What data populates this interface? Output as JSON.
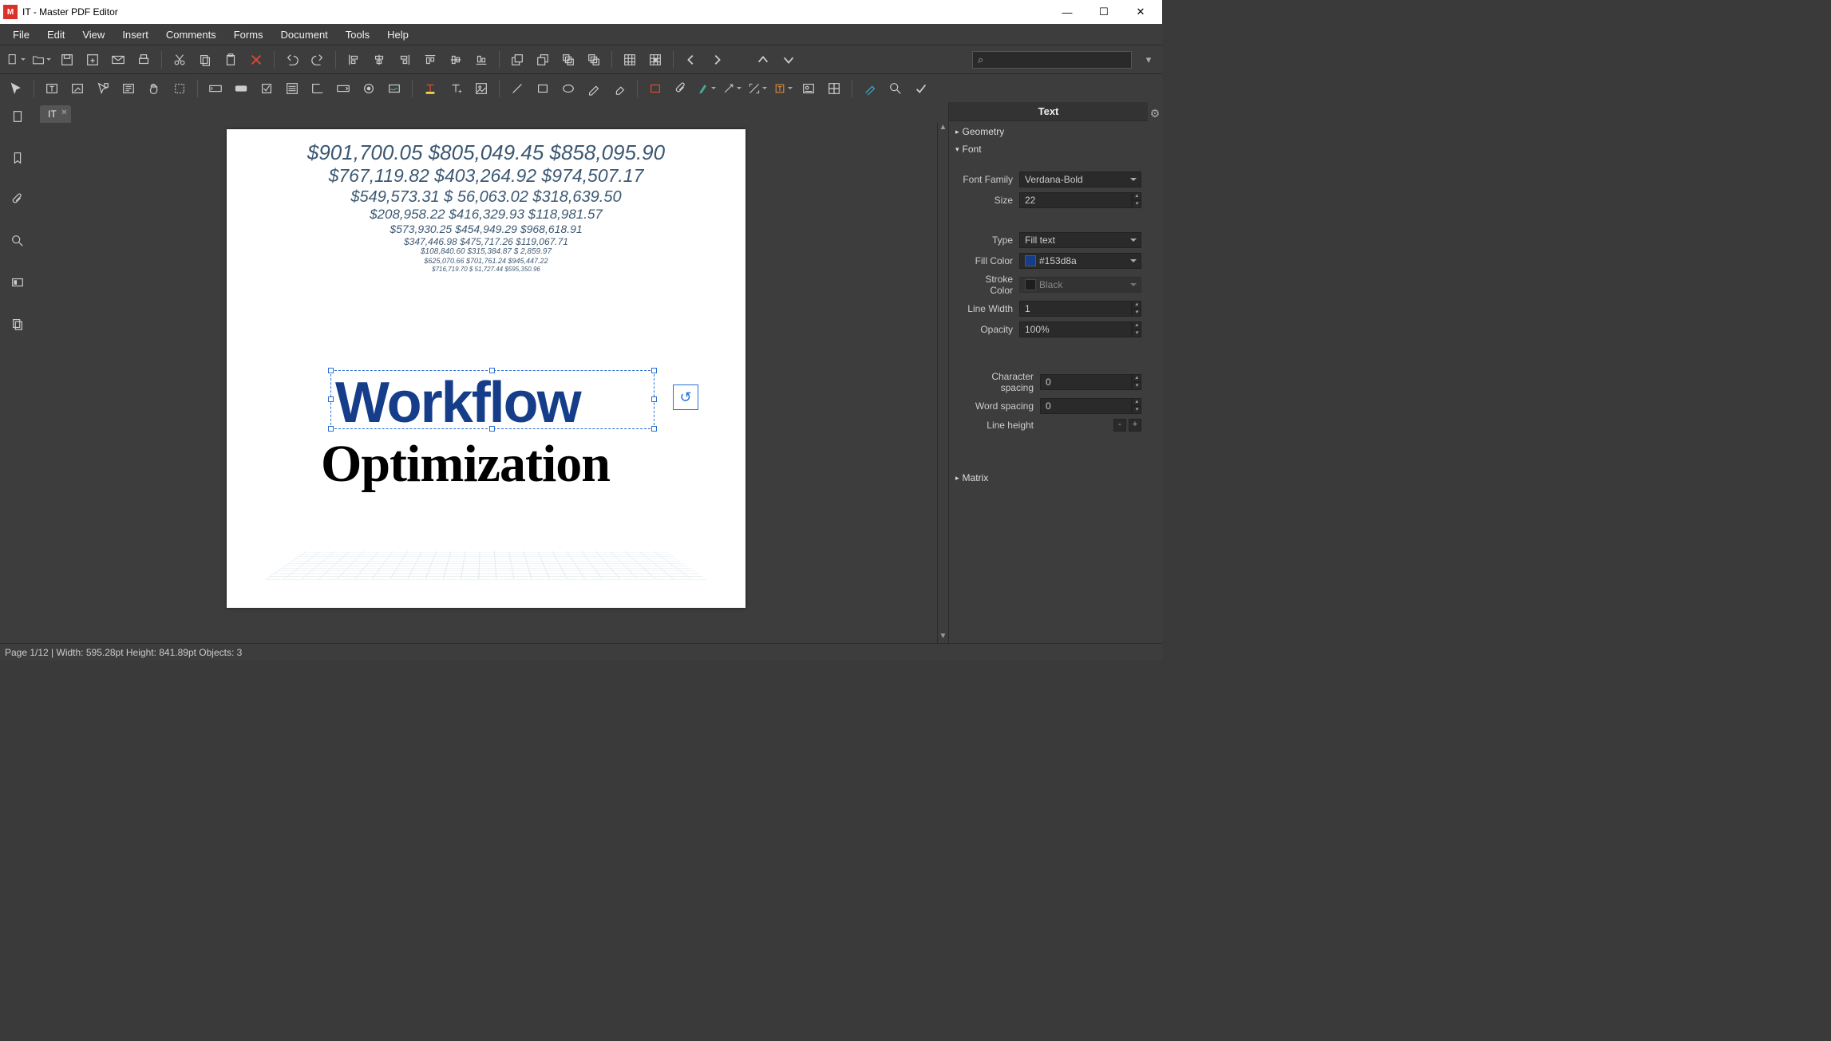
{
  "app": {
    "title": "IT - Master PDF Editor"
  },
  "menus": [
    "File",
    "Edit",
    "View",
    "Insert",
    "Comments",
    "Forms",
    "Document",
    "Tools",
    "Help"
  ],
  "tab": {
    "label": "IT"
  },
  "search_placeholder": "",
  "leftTools": [
    "pages",
    "bookmarks",
    "attachments",
    "search",
    "thumbnails",
    "layers"
  ],
  "document": {
    "bg_numbers": [
      "$901,700.05   $805,049.45   $858,095.90",
      "$767,119.82   $403,264.92   $974,507.17",
      "$549,573.31   $  56,063.02   $318,639.50",
      "$208,958.22   $416,329.93   $118,981.57",
      "$573,930.25   $454,949.29   $968,618.91",
      "$347,446.98   $475,717.26   $119,067.71",
      "$108,840.60   $315,384.87   $ 2,859.97",
      "$625,070.66   $701,761.24   $945,447.22",
      "$716,719.70   $ 51,727.44   $595,350.96"
    ],
    "selected_text": "Workflow",
    "sub_text": "Optimization"
  },
  "panel": {
    "title": "Text",
    "sections": {
      "geometry": "Geometry",
      "font": "Font",
      "matrix": "Matrix"
    },
    "font": {
      "family_label": "Font Family",
      "family": "Verdana-Bold",
      "size_label": "Size",
      "size": "22",
      "type_label": "Type",
      "type": "Fill text",
      "fill_label": "Fill Color",
      "fill": "#153d8a",
      "stroke_label": "Stroke Color",
      "stroke": "Black",
      "lw_label": "Line Width",
      "lw": "1",
      "op_label": "Opacity",
      "op": "100%",
      "cs_label": "Character spacing",
      "cs": "0",
      "ws_label": "Word spacing",
      "ws": "0",
      "lh_label": "Line height"
    }
  },
  "status": "Page 1/12 | Width: 595.28pt Height: 841.89pt Objects: 3"
}
